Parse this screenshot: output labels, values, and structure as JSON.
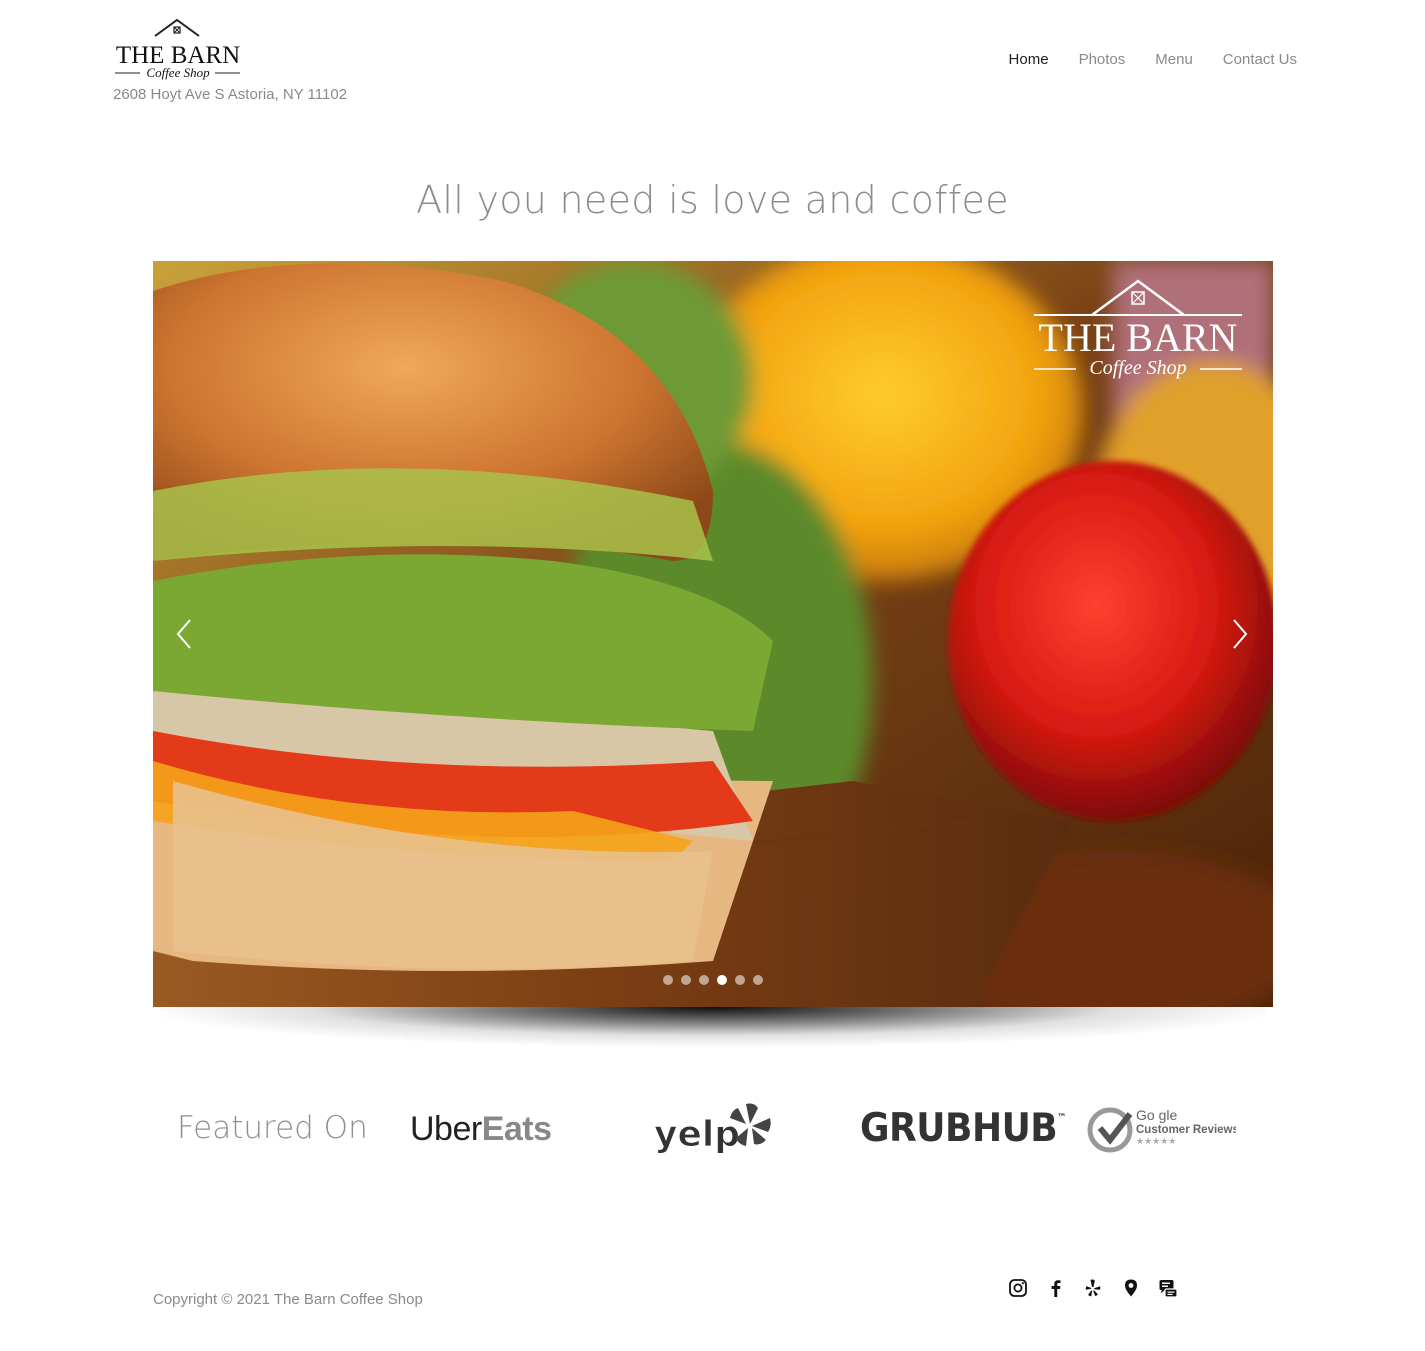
{
  "header": {
    "logo": {
      "title": "THE BARN",
      "subtitle": "Coffee Shop"
    },
    "address": "2608 Hoyt Ave S Astoria, NY 11102",
    "nav": [
      {
        "label": "Home",
        "active": true
      },
      {
        "label": "Photos",
        "active": false
      },
      {
        "label": "Menu",
        "active": false
      },
      {
        "label": "Contact Us",
        "active": false
      }
    ]
  },
  "hero": {
    "tagline": "All you need is love and coffee",
    "overlay_logo": {
      "title": "THE BARN",
      "subtitle": "Coffee Shop"
    },
    "slide_count": 6,
    "active_slide": 4,
    "prev_icon": "chevron-left-icon",
    "next_icon": "chevron-right-icon"
  },
  "featured": {
    "label": "Featured On",
    "uber_eats": {
      "part1": "Uber",
      "part2": "Eats"
    },
    "yelp": "yelp",
    "grubhub": "GRUBHUB",
    "grubhub_tm": "™",
    "google": {
      "line1": "Go  gle",
      "line2": "Customer Reviews",
      "stars": "★★★★★"
    }
  },
  "footer": {
    "copyright": "Copyright © 2021 The Barn Coffee Shop",
    "social_icons": [
      "instagram-icon",
      "facebook-icon",
      "yelp-icon",
      "map-pin-icon",
      "review-icon"
    ]
  }
}
